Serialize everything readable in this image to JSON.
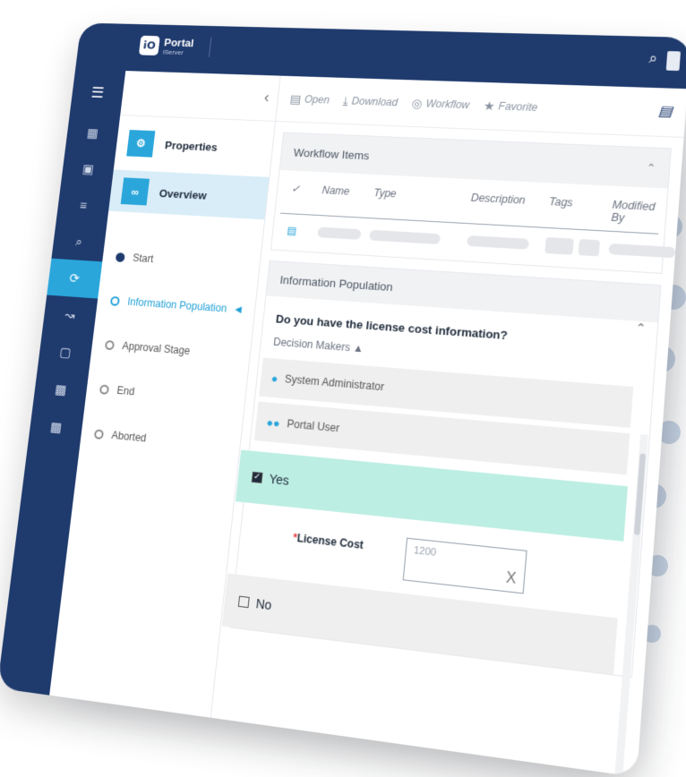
{
  "app": {
    "title": "Portal",
    "subtitle": "iServer",
    "logo_glyph": "iO"
  },
  "topbar": {
    "search_icon": "search-icon",
    "avatar_icon": "avatar"
  },
  "sidebar": {
    "menu_icon": "menu-icon",
    "items": [
      {
        "icon": "dashboard-icon"
      },
      {
        "icon": "folder-icon"
      },
      {
        "icon": "list-icon"
      },
      {
        "icon": "search-icon"
      },
      {
        "icon": "workflow-icon",
        "active": true
      },
      {
        "icon": "analytics-icon"
      },
      {
        "icon": "document-icon"
      },
      {
        "icon": "report-icon"
      },
      {
        "icon": "report-icon-2"
      }
    ]
  },
  "nav": {
    "collapse_glyph": "‹",
    "properties_label": "Properties",
    "overview_label": "Overview",
    "steps": [
      {
        "label": "Start",
        "state": "done"
      },
      {
        "label": "Information Population",
        "state": "current"
      },
      {
        "label": "Approval Stage",
        "state": "pending"
      },
      {
        "label": "End",
        "state": "pending"
      },
      {
        "label": "Aborted",
        "state": "pending"
      }
    ]
  },
  "toolbar": {
    "open_label": "Open",
    "download_label": "Download",
    "workflow_label": "Workflow",
    "favorite_label": "Favorite"
  },
  "workflow_items": {
    "title": "Workflow Items",
    "columns": [
      "Name",
      "Type",
      "Description",
      "Tags",
      "Modified By"
    ]
  },
  "info_population": {
    "title": "Information Population",
    "question": "Do you have the license cost information?",
    "decision_makers_label": "Decision Makers ▲",
    "decision_makers": [
      "System Administrator",
      "Portal User"
    ],
    "option_yes": "Yes",
    "license_label": "License Cost",
    "license_required_mark": "*",
    "license_value": "1200",
    "clear_glyph": "X",
    "option_no": "No"
  },
  "colors": {
    "primary": "#1f3a6d",
    "accent": "#2aa6db",
    "selected_bg": "#d8edf8",
    "yes_bg": "#bdeee3"
  }
}
